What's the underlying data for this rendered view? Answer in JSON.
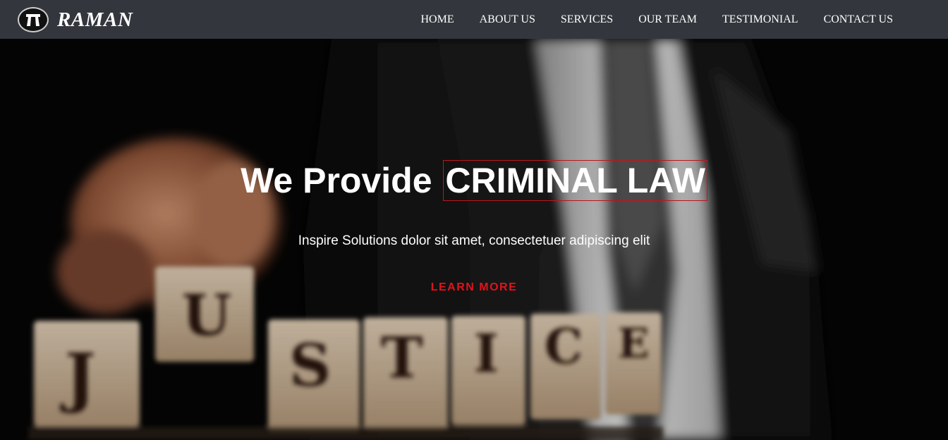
{
  "brand": {
    "name": "RAMAN",
    "logo_icon": "law-bands-icon"
  },
  "nav": {
    "items": [
      "HOME",
      "ABOUT US",
      "SERVICES",
      "OUR TEAM",
      "TESTIMONIAL",
      "CONTACT US"
    ]
  },
  "hero": {
    "title_prefix": "We Provide",
    "title_highlight": "CRIMINAL LAW",
    "subtitle": "Inspire Solutions dolor sit amet, consectetuer adipiscing elit",
    "cta_label": "LEARN MORE",
    "blocks": [
      "J",
      "U",
      "S",
      "T",
      "I",
      "C",
      "E"
    ],
    "background": "blurred-justice-blocks-photo"
  },
  "colors": {
    "navbar": "#33373d",
    "accent": "#e0141c",
    "highlight_border": "#c0151b"
  }
}
